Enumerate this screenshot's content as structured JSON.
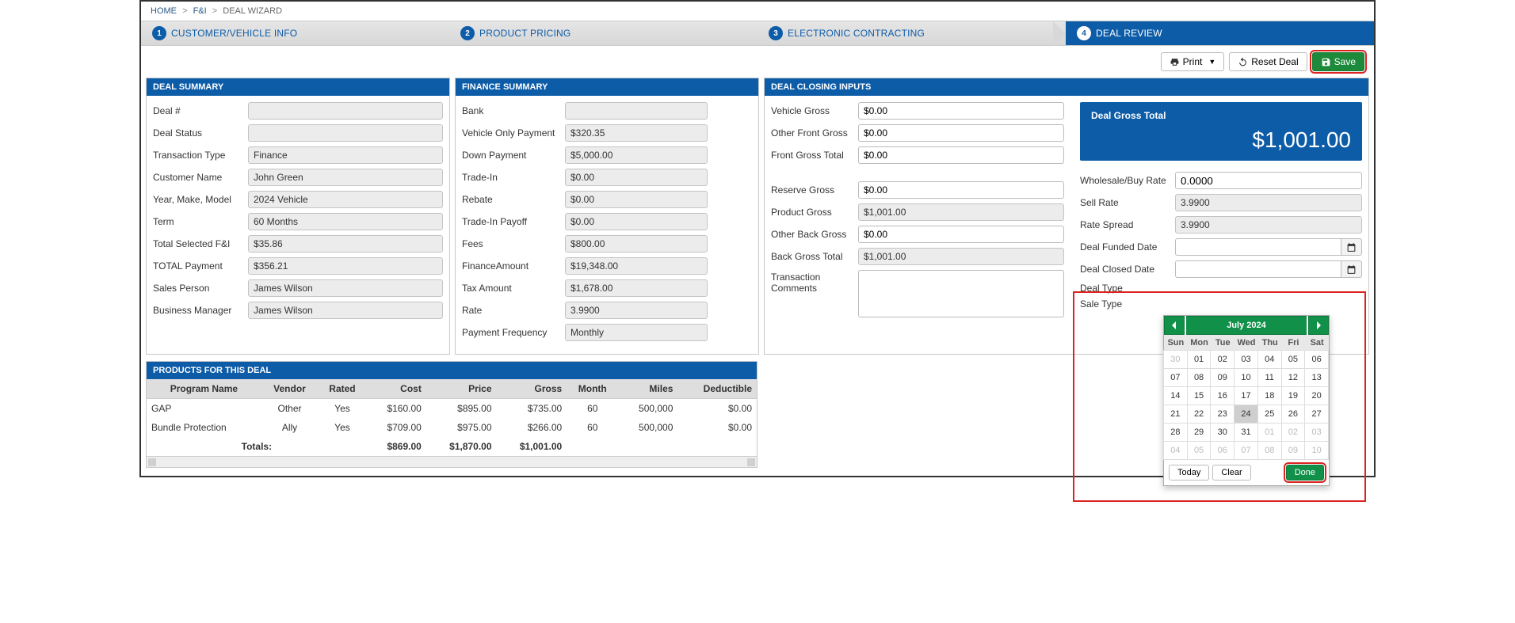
{
  "breadcrumb": {
    "home": "HOME",
    "fi": "F&I",
    "current": "DEAL WIZARD"
  },
  "steps": {
    "s1": "CUSTOMER/VEHICLE INFO",
    "s2": "PRODUCT PRICING",
    "s3": "ELECTRONIC CONTRACTING",
    "s4": "DEAL REVIEW"
  },
  "actions": {
    "print": "Print",
    "reset": "Reset Deal",
    "save": "Save"
  },
  "dealSummary": {
    "title": "DEAL SUMMARY",
    "dealNumLabel": "Deal #",
    "dealNum": "",
    "statusLabel": "Deal Status",
    "status": "",
    "txnTypeLabel": "Transaction Type",
    "txnType": "Finance",
    "custLabel": "Customer Name",
    "cust": "John Green",
    "ymmLabel": "Year, Make, Model",
    "ymm": "2024 Vehicle",
    "termLabel": "Term",
    "term": "60 Months",
    "fiLabel": "Total Selected F&I",
    "fi": "$35.86",
    "totalPayLabel": "TOTAL Payment",
    "totalPay": "$356.21",
    "salesLabel": "Sales Person",
    "sales": "James Wilson",
    "bmLabel": "Business Manager",
    "bm": "James Wilson"
  },
  "financeSummary": {
    "title": "FINANCE SUMMARY",
    "bankLabel": "Bank",
    "bank": "",
    "vopLabel": "Vehicle Only Payment",
    "vop": "$320.35",
    "downLabel": "Down Payment",
    "down": "$5,000.00",
    "tradeLabel": "Trade-In",
    "trade": "$0.00",
    "rebateLabel": "Rebate",
    "rebate": "$0.00",
    "payoffLabel": "Trade-In Payoff",
    "payoff": "$0.00",
    "feesLabel": "Fees",
    "fees": "$800.00",
    "finAmtLabel": "FinanceAmount",
    "finAmt": "$19,348.00",
    "taxLabel": "Tax Amount",
    "tax": "$1,678.00",
    "rateLabel": "Rate",
    "rate": "3.9900",
    "freqLabel": "Payment Frequency",
    "freq": "Monthly"
  },
  "closing": {
    "title": "DEAL CLOSING INPUTS",
    "vehicleGrossLabel": "Vehicle Gross",
    "vehicleGross": "$0.00",
    "otherFrontLabel": "Other Front Gross",
    "otherFront": "$0.00",
    "frontTotalLabel": "Front Gross Total",
    "frontTotal": "$0.00",
    "reserveLabel": "Reserve Gross",
    "reserve": "$0.00",
    "productGrossLabel": "Product Gross",
    "productGross": "$1,001.00",
    "otherBackLabel": "Other Back Gross",
    "otherBack": "$0.00",
    "backTotalLabel": "Back Gross Total",
    "backTotal": "$1,001.00",
    "commentsLabel": "Transaction Comments",
    "grossTotalLabel": "Deal Gross Total",
    "grossTotal": "$1,001.00",
    "wbrLabel": "Wholesale/Buy Rate",
    "wbr": "0.0000",
    "sellRateLabel": "Sell Rate",
    "sellRate": "3.9900",
    "spreadLabel": "Rate Spread",
    "spread": "3.9900",
    "fundedLabel": "Deal Funded Date",
    "closedLabel": "Deal Closed Date",
    "dealTypeLabel": "Deal Type",
    "saleTypeLabel": "Sale Type"
  },
  "products": {
    "title": "PRODUCTS FOR THIS DEAL",
    "headers": {
      "program": "Program Name",
      "vendor": "Vendor",
      "rated": "Rated",
      "cost": "Cost",
      "price": "Price",
      "gross": "Gross",
      "month": "Month",
      "miles": "Miles",
      "ded": "Deductible"
    },
    "rows": [
      {
        "program": "GAP",
        "vendor": "Other",
        "rated": "Yes",
        "cost": "$160.00",
        "price": "$895.00",
        "gross": "$735.00",
        "month": "60",
        "miles": "500,000",
        "ded": "$0.00"
      },
      {
        "program": "Bundle Protection",
        "vendor": "Ally",
        "rated": "Yes",
        "cost": "$709.00",
        "price": "$975.00",
        "gross": "$266.00",
        "month": "60",
        "miles": "500,000",
        "ded": "$0.00"
      }
    ],
    "totalsLabel": "Totals:",
    "totals": {
      "cost": "$869.00",
      "price": "$1,870.00",
      "gross": "$1,001.00"
    }
  },
  "datepicker": {
    "monthTitle": "July 2024",
    "dow": [
      "Sun",
      "Mon",
      "Tue",
      "Wed",
      "Thu",
      "Fri",
      "Sat"
    ],
    "cells": [
      {
        "d": "30",
        "o": true
      },
      {
        "d": "01"
      },
      {
        "d": "02"
      },
      {
        "d": "03"
      },
      {
        "d": "04"
      },
      {
        "d": "05"
      },
      {
        "d": "06"
      },
      {
        "d": "07"
      },
      {
        "d": "08"
      },
      {
        "d": "09"
      },
      {
        "d": "10"
      },
      {
        "d": "11"
      },
      {
        "d": "12"
      },
      {
        "d": "13"
      },
      {
        "d": "14"
      },
      {
        "d": "15"
      },
      {
        "d": "16"
      },
      {
        "d": "17"
      },
      {
        "d": "18"
      },
      {
        "d": "19"
      },
      {
        "d": "20"
      },
      {
        "d": "21"
      },
      {
        "d": "22"
      },
      {
        "d": "23"
      },
      {
        "d": "24",
        "t": true
      },
      {
        "d": "25"
      },
      {
        "d": "26"
      },
      {
        "d": "27"
      },
      {
        "d": "28"
      },
      {
        "d": "29"
      },
      {
        "d": "30"
      },
      {
        "d": "31"
      },
      {
        "d": "01",
        "o": true
      },
      {
        "d": "02",
        "o": true
      },
      {
        "d": "03",
        "o": true
      },
      {
        "d": "04",
        "o": true
      },
      {
        "d": "05",
        "o": true
      },
      {
        "d": "06",
        "o": true
      },
      {
        "d": "07",
        "o": true
      },
      {
        "d": "08",
        "o": true
      },
      {
        "d": "09",
        "o": true
      },
      {
        "d": "10",
        "o": true
      }
    ],
    "today": "Today",
    "clear": "Clear",
    "done": "Done"
  }
}
